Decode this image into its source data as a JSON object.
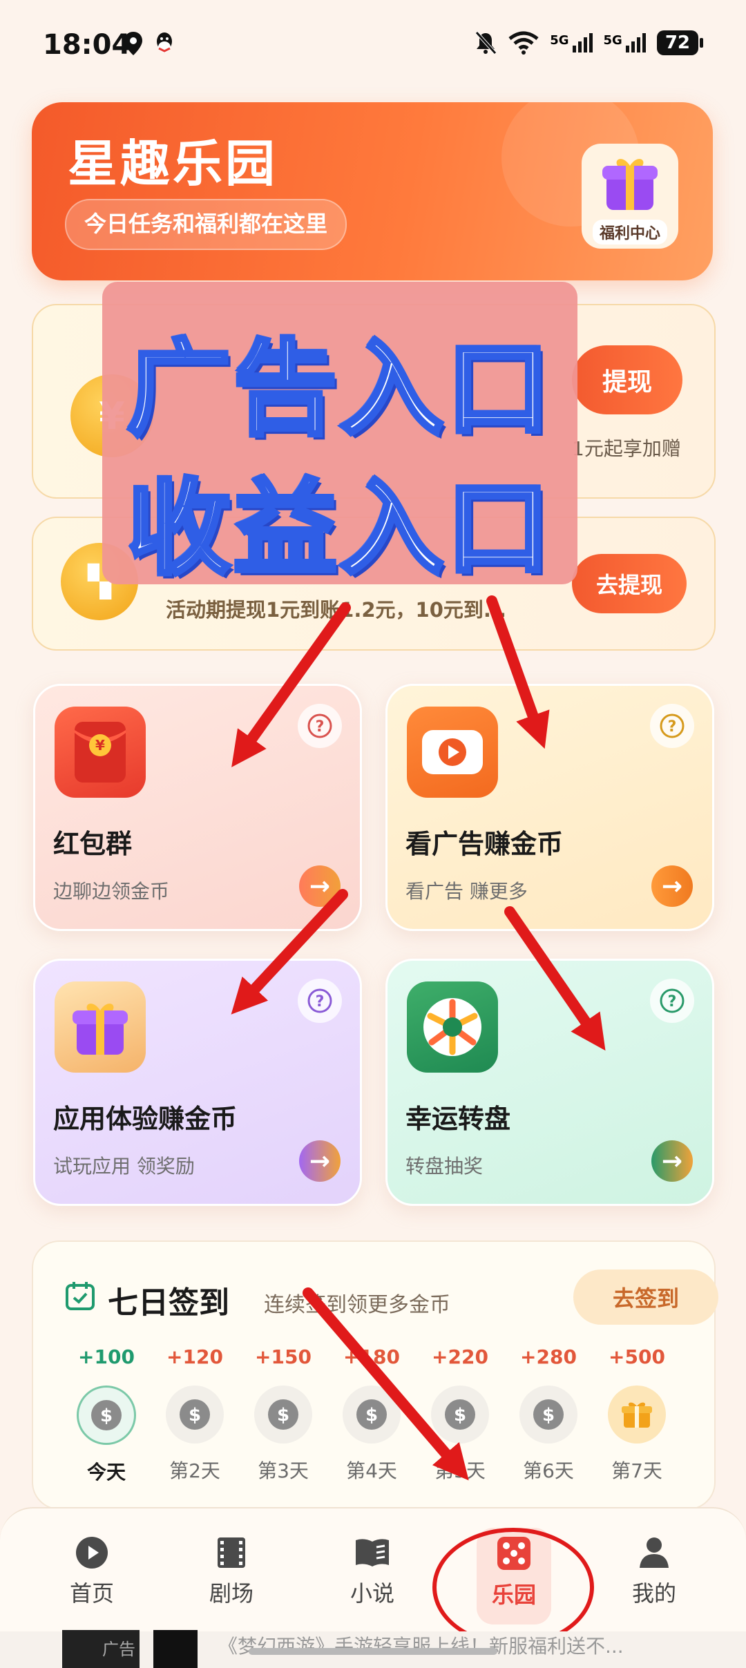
{
  "status_bar": {
    "time": "18:04",
    "battery": "72",
    "network_labels": [
      "5G",
      "5G"
    ],
    "icons": [
      "location-icon",
      "qq-icon",
      "mute-bell-icon",
      "wifi-icon",
      "signal-icon",
      "battery-icon"
    ]
  },
  "hero": {
    "title": "星趣乐园",
    "subtitle": "今日任务和福利都在这里",
    "welfare_label": "福利中心"
  },
  "wallet": {
    "withdraw_button": "提现",
    "bonus_text": "1元起享加赠"
  },
  "withdraw_promo": {
    "text": "活动期提现1元到账1.2元，10元到...",
    "button": "去提现"
  },
  "overlay": {
    "line1": "广告入口",
    "line2": "收益入口"
  },
  "features": [
    {
      "title": "红包群",
      "subtitle": "边聊边领金币",
      "icon": "red-envelope-icon"
    },
    {
      "title": "看广告赚金币",
      "subtitle": "看广告 赚更多",
      "icon": "video-play-icon"
    },
    {
      "title": "应用体验赚金币",
      "subtitle": "试玩应用 领奖励",
      "icon": "gift-box-icon"
    },
    {
      "title": "幸运转盘",
      "subtitle": "转盘抽奖",
      "icon": "lucky-wheel-icon"
    }
  ],
  "checkin": {
    "title": "七日签到",
    "subtitle": "连续签到领更多金币",
    "button": "去签到",
    "days": [
      {
        "reward": "+100",
        "label": "今天"
      },
      {
        "reward": "+120",
        "label": "第2天"
      },
      {
        "reward": "+150",
        "label": "第3天"
      },
      {
        "reward": "+180",
        "label": "第4天"
      },
      {
        "reward": "+220",
        "label": "第5天"
      },
      {
        "reward": "+280",
        "label": "第6天"
      },
      {
        "reward": "+500",
        "label": "第7天"
      }
    ]
  },
  "bottom_nav": {
    "items": [
      {
        "label": "首页",
        "icon": "play-circle-icon"
      },
      {
        "label": "剧场",
        "icon": "film-icon"
      },
      {
        "label": "小说",
        "icon": "book-icon"
      },
      {
        "label": "乐园",
        "icon": "dice-icon"
      },
      {
        "label": "我的",
        "icon": "user-icon"
      }
    ],
    "active": "乐园"
  },
  "ad_strip": {
    "badge": "广告",
    "text": "《梦幻西游》手游轻享服上线！新服福利送不..."
  },
  "colors": {
    "accent_orange": "#f45a2a",
    "annotation_red": "#e01a1a",
    "overlay_pink": "#f09694",
    "overlay_stroke_blue": "#2f5ee6"
  }
}
